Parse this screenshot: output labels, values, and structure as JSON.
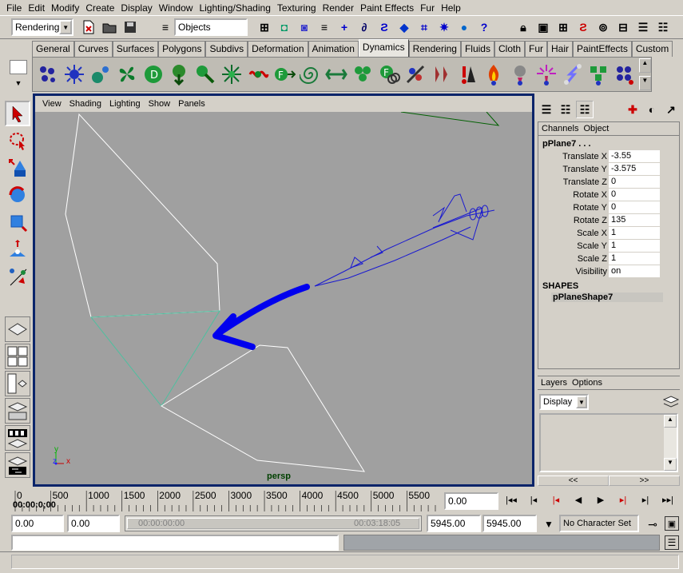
{
  "menubar": [
    "File",
    "Edit",
    "Modify",
    "Create",
    "Display",
    "Window",
    "Lighting/Shading",
    "Texturing",
    "Render",
    "Paint Effects",
    "Fur",
    "Help"
  ],
  "statusline": {
    "menuset": "Rendering",
    "selection_mask": "Objects"
  },
  "shelf_tabs": [
    "General",
    "Curves",
    "Surfaces",
    "Polygons",
    "Subdivs",
    "Deformation",
    "Animation",
    "Dynamics",
    "Rendering",
    "Fluids",
    "Cloth",
    "Fur",
    "Hair",
    "PaintEffects",
    "Custom"
  ],
  "active_shelf_tab": "Dynamics",
  "viewport": {
    "menus": [
      "View",
      "Shading",
      "Lighting",
      "Show",
      "Panels"
    ],
    "camera_label": "persp",
    "axis_y": "y",
    "axis_z": "z",
    "axis_x": "x"
  },
  "channel_box": {
    "tabs": [
      "Channels",
      "Object"
    ],
    "object_name": "pPlane7 . . .",
    "channels": [
      {
        "label": "Translate X",
        "value": "-3.55"
      },
      {
        "label": "Translate Y",
        "value": "-3.575"
      },
      {
        "label": "Translate Z",
        "value": "0"
      },
      {
        "label": "Rotate X",
        "value": "0"
      },
      {
        "label": "Rotate Y",
        "value": "0"
      },
      {
        "label": "Rotate Z",
        "value": "135"
      },
      {
        "label": "Scale X",
        "value": "1"
      },
      {
        "label": "Scale Y",
        "value": "1"
      },
      {
        "label": "Scale Z",
        "value": "1"
      },
      {
        "label": "Visibility",
        "value": "on"
      }
    ],
    "shapes_header": "SHAPES",
    "shape_name": "pPlaneShape7"
  },
  "layers": {
    "menus": [
      "Layers",
      "Options"
    ],
    "mode": "Display",
    "nav_left": "<<",
    "nav_right": ">>"
  },
  "timeline": {
    "ticks": [
      "0",
      "500",
      "1000",
      "1500",
      "2000",
      "2500",
      "3000",
      "3500",
      "4000",
      "4500",
      "5000",
      "5500"
    ],
    "timecode": "00:00:0;00",
    "current_frame": "0.00"
  },
  "range": {
    "start_time": "0.00",
    "playback_start": "0.00",
    "range_start_tc": "00:00:00:00",
    "range_end_tc": "00:03:18:05",
    "playback_end": "5945.00",
    "end_time": "5945.00",
    "character_set": "No Character Set"
  },
  "colors": {
    "viewport_border": "#0a246a",
    "arrow_blue": "#0000ee",
    "plane_selected": "#4fbf9f",
    "camera_green": "#006000"
  }
}
